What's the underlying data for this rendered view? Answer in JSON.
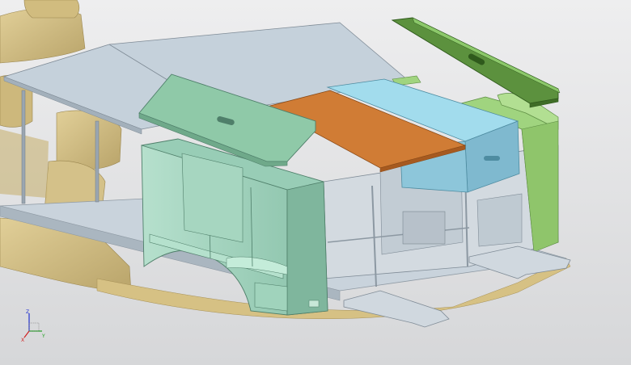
{
  "viewport": {
    "background_top": "#e9e9ea",
    "background_bottom": "#d7d8da",
    "part_colors": {
      "scan_mesh": "#d8c48c",
      "floor_panel": "#c4d1db",
      "partition_cabinet": "#a9d7c2",
      "lid_panel": "#8fc9a8",
      "orange_panel": "#cf7a33",
      "cyan_drawer": "#9bd6e8",
      "green_side_frame": "#9fd27f",
      "dark_green_lid": "#5a8f3c",
      "frame_gray": "#cfd5db"
    }
  },
  "axis_triad": {
    "x_label": "X",
    "y_label": "Y",
    "z_label": "Z",
    "x_color": "#d02020",
    "y_color": "#20a020",
    "z_color": "#2030d0"
  }
}
